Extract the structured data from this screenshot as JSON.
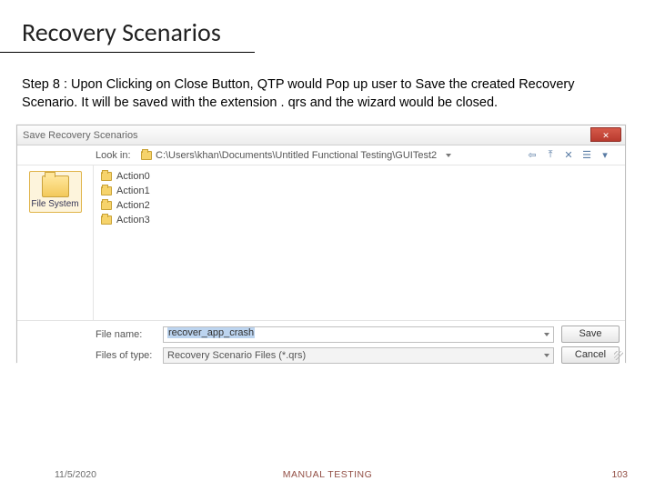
{
  "title": "Recovery Scenarios",
  "step_text": "Step 8 : Upon Clicking on Close Button, QTP would Pop up user to Save the created Recovery Scenario. It will be saved with the extension . qrs and the wizard would be closed.",
  "dialog": {
    "title": "Save Recovery Scenarios",
    "close_glyph": "✕",
    "lookin_label": "Look in:",
    "lookin_path": "C:\\Users\\khan\\Documents\\Untitled Functional Testing\\GUITest2",
    "nav": {
      "back": "⇦",
      "up": "⤒",
      "new": "✕",
      "view": "☰",
      "menu": "▾"
    },
    "sidebar": {
      "file_system": "File System"
    },
    "files": [
      "Action0",
      "Action1",
      "Action2",
      "Action3"
    ],
    "filename_label": "File name:",
    "filename_value": "recover_app_crash",
    "filetype_label": "Files of type:",
    "filetype_value": "Recovery Scenario Files (*.qrs)",
    "save_btn": "Save",
    "cancel_btn": "Cancel"
  },
  "footer": {
    "date": "11/5/2020",
    "center": "MANUAL TESTING",
    "page": "103"
  }
}
